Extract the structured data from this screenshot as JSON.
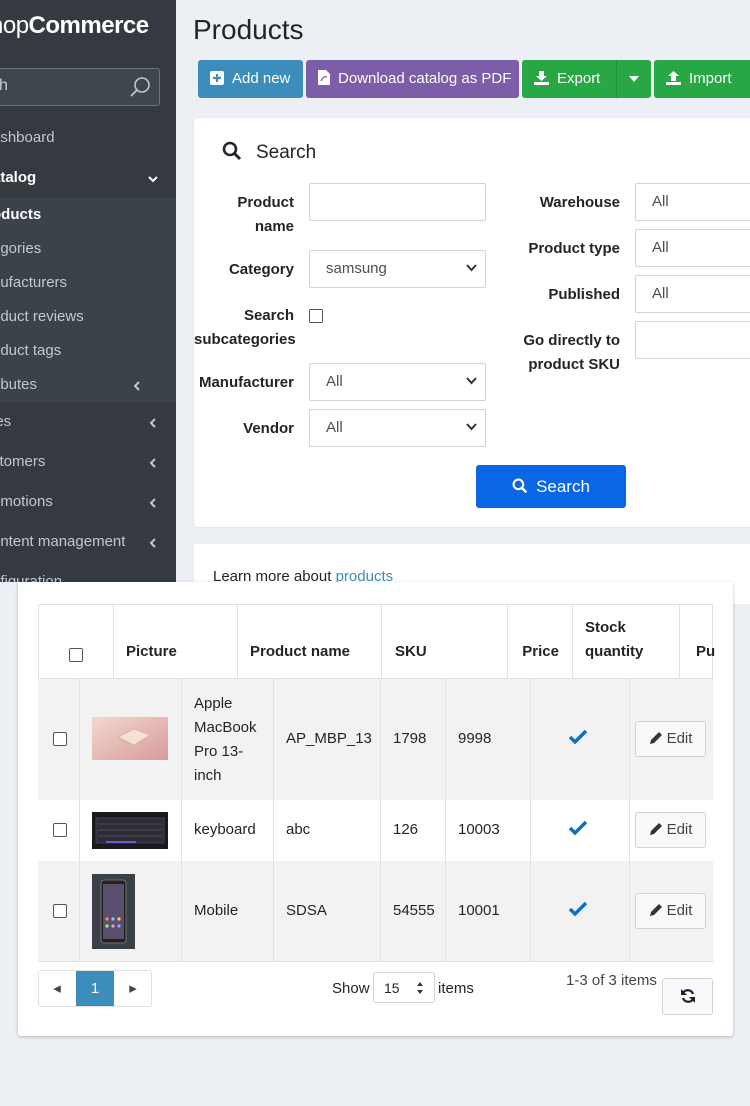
{
  "sidebar": {
    "brand_prefix": "nop",
    "brand_suffix": "Commerce",
    "search_placeholder": "h",
    "items": [
      {
        "label": "ashboard"
      },
      {
        "label": "atalog"
      },
      {
        "label": "les"
      },
      {
        "label": "stomers"
      },
      {
        "label": "omotions"
      },
      {
        "label": "ontent management"
      },
      {
        "label": "nfiguration"
      }
    ],
    "catalog_sub": [
      {
        "label": "oducts"
      },
      {
        "label": "egories"
      },
      {
        "label": "nufacturers"
      },
      {
        "label": "oduct reviews"
      },
      {
        "label": "oduct tags"
      },
      {
        "label": "ributes"
      }
    ]
  },
  "header": {
    "title": "Products",
    "add_new": "Add new",
    "download_pdf": "Download catalog as PDF",
    "export": "Export",
    "import": "Import"
  },
  "search": {
    "title": "Search",
    "product_name_label_1": "Product",
    "product_name_label_2": "name",
    "product_name_value": "",
    "category_label": "Category",
    "category_value": "samsung",
    "subcat_label_1": "Search",
    "subcat_label_2": "subcategories",
    "manufacturer_label": "Manufacturer",
    "manufacturer_value": "All",
    "vendor_label": "Vendor",
    "vendor_value": "All",
    "warehouse_label": "Warehouse",
    "warehouse_value": "All",
    "product_type_label": "Product type",
    "product_type_value": "All",
    "published_label": "Published",
    "published_value": "All",
    "sku_label_1": "Go directly to",
    "sku_label_2": "product SKU",
    "button": "Search"
  },
  "learn": {
    "prefix": "Learn more about ",
    "link": "products"
  },
  "grid": {
    "columns": {
      "picture": "Picture",
      "product_name": "Product name",
      "sku": "SKU",
      "price": "Price",
      "stock_1": "Stock",
      "stock_2": "quantity",
      "published": "Pu"
    },
    "rows": [
      {
        "name_lines": [
          "Apple",
          "MacBook",
          "Pro 13-",
          "inch"
        ],
        "sku": "AP_MBP_13",
        "price": "1798",
        "stock": "9998",
        "edit": "Edit"
      },
      {
        "name_lines": [
          "keyboard"
        ],
        "sku": "abc",
        "price": "126",
        "stock": "10003",
        "edit": "Edit"
      },
      {
        "name_lines": [
          "Mobile"
        ],
        "sku": "SDSA",
        "price": "54555",
        "stock": "10001",
        "edit": "Edit"
      }
    ],
    "pager": {
      "prev": "◂",
      "current": "1",
      "next": "▸"
    },
    "show_label": "Show",
    "page_size": "15",
    "items_label": "items",
    "count_text": "1-3 of 3 items"
  }
}
